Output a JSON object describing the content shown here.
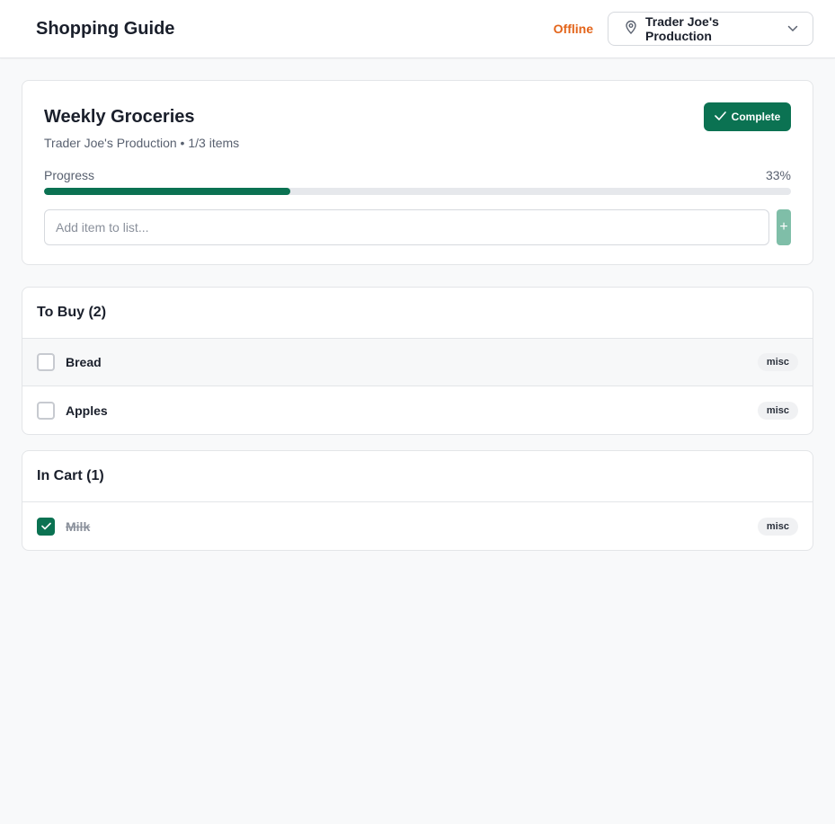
{
  "header": {
    "title": "Shopping Guide",
    "status": "Offline",
    "store": "Trader Joe's Production",
    "store_icon": "map-pin-icon",
    "chevron_icon": "chevron-down-icon"
  },
  "list": {
    "title": "Weekly Groceries",
    "subtitle": "Trader Joe's Production • 1/3 items",
    "complete_label": "Complete",
    "progress_label": "Progress",
    "progress_text": "33%",
    "progress_fraction": 0.33,
    "add_placeholder": "Add item to list...",
    "add_button": "+"
  },
  "to_buy": {
    "heading": "To Buy (2)",
    "items": [
      {
        "name": "Bread",
        "tag": "misc",
        "checked": false
      },
      {
        "name": "Apples",
        "tag": "misc",
        "checked": false
      }
    ]
  },
  "in_cart": {
    "heading": "In Cart (1)",
    "items": [
      {
        "name": "Milk",
        "tag": "misc",
        "checked": true
      }
    ]
  },
  "colors": {
    "accent": "#0b7252",
    "status": "#e3641a"
  }
}
